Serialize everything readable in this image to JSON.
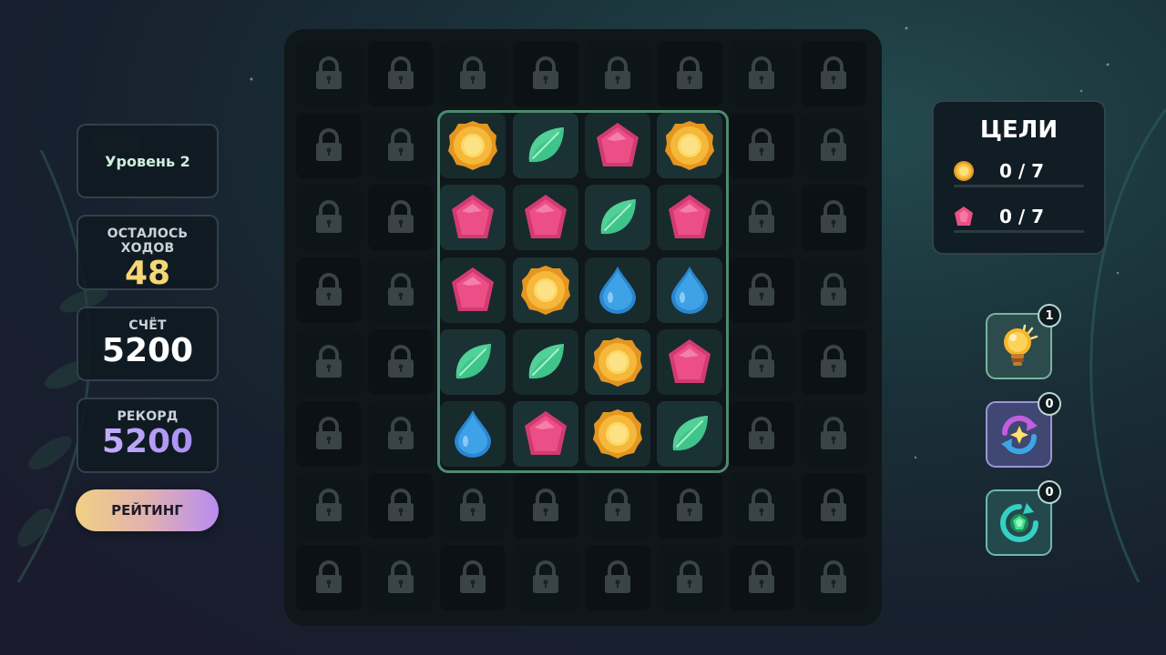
{
  "hud": {
    "level_label": "Уровень 2",
    "moves_label": "ОСТАЛОСЬ ХОДОВ",
    "moves_value": "48",
    "score_label": "СЧЁТ",
    "score_value": "5200",
    "record_label": "РЕКОРД",
    "record_value": "5200",
    "rating_button": "РЕЙТИНГ"
  },
  "goals": {
    "title": "ЦЕЛИ",
    "items": [
      {
        "icon": "coin-icon",
        "progress": "0 / 7"
      },
      {
        "icon": "pink-gem-icon",
        "progress": "0 / 7"
      }
    ]
  },
  "boosters": [
    {
      "name": "hint-lightbulb-icon",
      "count": "1"
    },
    {
      "name": "shuffle-icon",
      "count": "0"
    },
    {
      "name": "refresh-gem-icon",
      "count": "0"
    }
  ],
  "board": {
    "rows": 8,
    "cols": 8,
    "grid": [
      [
        "lock",
        "lock",
        "lock",
        "lock",
        "lock",
        "lock",
        "lock",
        "lock"
      ],
      [
        "lock",
        "lock",
        "coin",
        "leaf",
        "pink",
        "coin",
        "lock",
        "lock"
      ],
      [
        "lock",
        "lock",
        "pink",
        "pink",
        "leaf",
        "pink",
        "lock",
        "lock"
      ],
      [
        "lock",
        "lock",
        "pink",
        "coin",
        "drop",
        "drop",
        "lock",
        "lock"
      ],
      [
        "lock",
        "lock",
        "leaf",
        "leaf",
        "coin",
        "pink",
        "lock",
        "lock"
      ],
      [
        "lock",
        "lock",
        "drop",
        "pink",
        "coin",
        "leaf",
        "lock",
        "lock"
      ],
      [
        "lock",
        "lock",
        "lock",
        "lock",
        "lock",
        "lock",
        "lock",
        "lock"
      ],
      [
        "lock",
        "lock",
        "lock",
        "lock",
        "lock",
        "lock",
        "lock",
        "lock"
      ]
    ]
  },
  "colors": {
    "coin": "#f5b83a",
    "leaf": "#3fc48a",
    "pink": "#ec4f86",
    "drop": "#3ea2e6",
    "lock": "#3a4448",
    "moves": "#f7d774",
    "active_border": "#4e8a70"
  }
}
